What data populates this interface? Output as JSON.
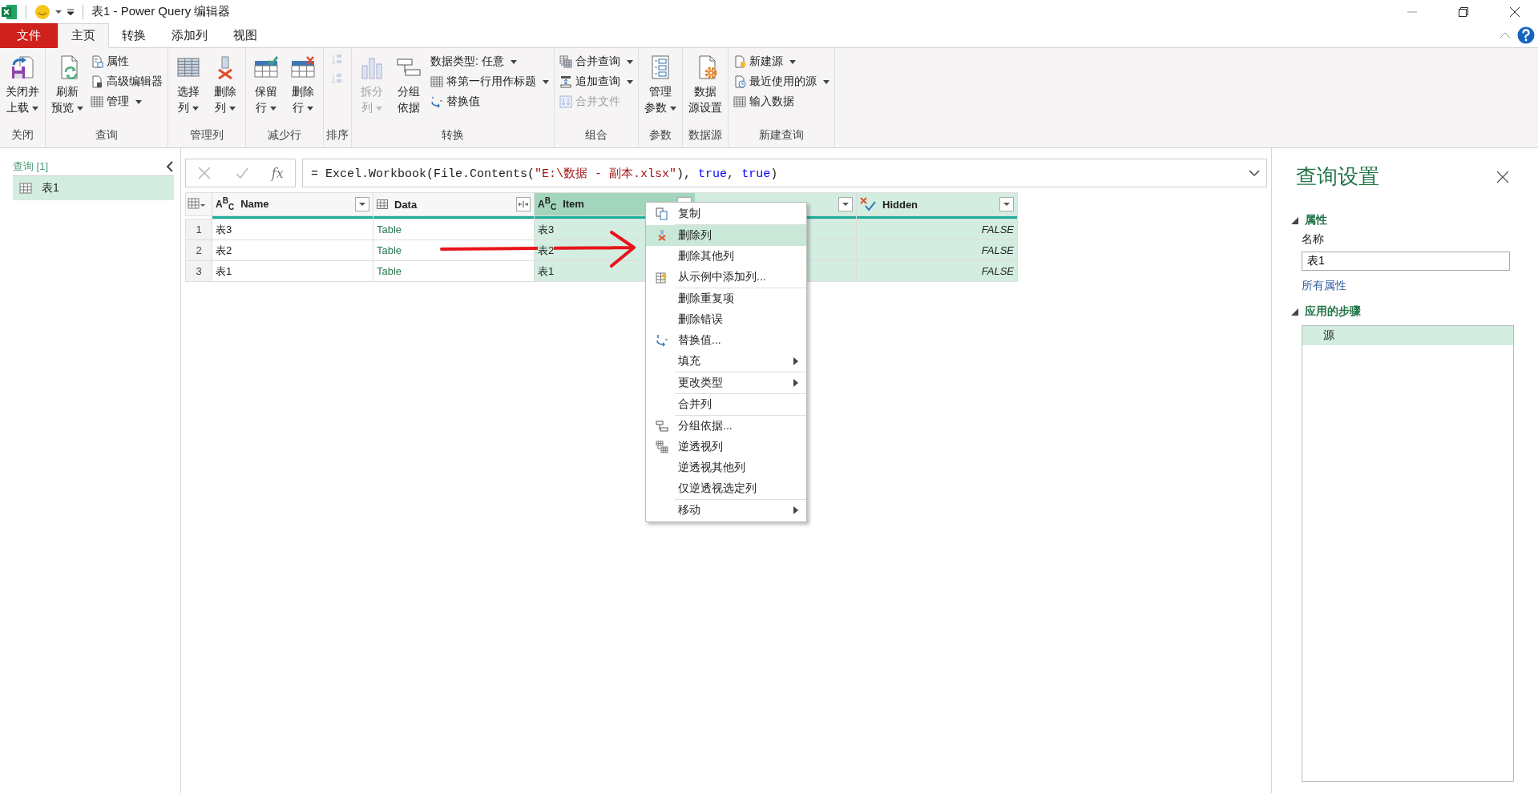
{
  "window": {
    "title": "表1 - Power Query 编辑器"
  },
  "menu_tabs": [
    {
      "label": "文件",
      "kind": "file",
      "selected": false
    },
    {
      "label": "主页",
      "kind": "tab",
      "selected": true
    },
    {
      "label": "转换",
      "kind": "tab",
      "selected": false
    },
    {
      "label": "添加列",
      "kind": "tab",
      "selected": false
    },
    {
      "label": "视图",
      "kind": "tab",
      "selected": false
    }
  ],
  "ribbon": {
    "groups": [
      {
        "label": "关闭",
        "items": [
          {
            "kind": "large",
            "lines": [
              "关闭并",
              "上载"
            ],
            "dropdown": true,
            "disabled": false
          }
        ]
      },
      {
        "label": "查询",
        "items": [
          {
            "kind": "large",
            "lines": [
              "刷新",
              "预览"
            ],
            "dropdown": true,
            "disabled": false
          },
          {
            "kind": "small",
            "label": "属性",
            "dropdown": false,
            "disabled": false
          },
          {
            "kind": "small",
            "label": "高级编辑器",
            "dropdown": false,
            "disabled": false
          },
          {
            "kind": "small",
            "label": "管理",
            "dropdown": true,
            "disabled": false
          }
        ]
      },
      {
        "label": "管理列",
        "items": [
          {
            "kind": "large",
            "lines": [
              "选择",
              "列"
            ],
            "dropdown": true,
            "disabled": false
          },
          {
            "kind": "large",
            "lines": [
              "删除",
              "列"
            ],
            "dropdown": true,
            "disabled": false
          }
        ]
      },
      {
        "label": "减少行",
        "items": [
          {
            "kind": "large",
            "lines": [
              "保留",
              "行"
            ],
            "dropdown": true,
            "disabled": false
          },
          {
            "kind": "large",
            "lines": [
              "删除",
              "行"
            ],
            "dropdown": true,
            "disabled": false
          }
        ]
      },
      {
        "label": "排序",
        "items": [
          {
            "kind": "icon",
            "disabled": true
          },
          {
            "kind": "icon",
            "disabled": true
          }
        ]
      },
      {
        "label": "转换",
        "items": [
          {
            "kind": "large",
            "lines": [
              "拆分",
              "列"
            ],
            "dropdown": true,
            "disabled": true
          },
          {
            "kind": "large",
            "lines": [
              "分组",
              "依据"
            ],
            "dropdown": false,
            "disabled": false
          },
          {
            "kind": "small",
            "label": "数据类型: 任意",
            "dropdown": true,
            "disabled": false
          },
          {
            "kind": "small",
            "label": "将第一行用作标题",
            "dropdown": true,
            "disabled": false
          },
          {
            "kind": "small",
            "label": "替换值",
            "dropdown": false,
            "disabled": false
          }
        ]
      },
      {
        "label": "组合",
        "items": [
          {
            "kind": "small",
            "label": "合并查询",
            "dropdown": true,
            "disabled": false
          },
          {
            "kind": "small",
            "label": "追加查询",
            "dropdown": true,
            "disabled": false
          },
          {
            "kind": "small",
            "label": "合并文件",
            "dropdown": false,
            "disabled": true
          }
        ]
      },
      {
        "label": "参数",
        "items": [
          {
            "kind": "large",
            "lines": [
              "管理",
              "参数"
            ],
            "dropdown": true,
            "disabled": false
          }
        ]
      },
      {
        "label": "数据源",
        "items": [
          {
            "kind": "large",
            "lines": [
              "数据",
              "源设置"
            ],
            "dropdown": false,
            "disabled": false
          }
        ]
      },
      {
        "label": "新建查询",
        "items": [
          {
            "kind": "small",
            "label": "新建源",
            "dropdown": true,
            "disabled": false
          },
          {
            "kind": "small",
            "label": "最近使用的源",
            "dropdown": true,
            "disabled": false
          },
          {
            "kind": "small",
            "label": "输入数据",
            "dropdown": false,
            "disabled": false
          }
        ]
      }
    ]
  },
  "queries": {
    "header": "查询 [1]",
    "items": [
      {
        "label": "表1",
        "selected": true
      }
    ]
  },
  "formula_bar": {
    "fx": "fx",
    "tokens": [
      {
        "text": "= Excel.Workbook(File.Contents(",
        "kind": "plain"
      },
      {
        "text": "\"E:\\数据 - 副本.xlsx\"",
        "kind": "string"
      },
      {
        "text": "), ",
        "kind": "plain"
      },
      {
        "text": "true",
        "kind": "keyword"
      },
      {
        "text": ", ",
        "kind": "plain"
      },
      {
        "text": "true",
        "kind": "keyword"
      },
      {
        "text": ")",
        "kind": "plain"
      }
    ]
  },
  "table": {
    "columns": [
      {
        "label": "Name",
        "kind": "text",
        "type_label": "A$^{B}$$_{C}$",
        "selected": false,
        "focused": false
      },
      {
        "label": "Data",
        "kind": "table",
        "selected": false,
        "focused": false
      },
      {
        "label": "Item",
        "kind": "text",
        "type_label": "A$^{B}$$_{C}$",
        "selected": true,
        "focused": true
      },
      {
        "kind": "covered",
        "selected": true,
        "focused": false
      },
      {
        "label": "Hidden",
        "kind": "logical",
        "selected": true,
        "focused": false
      }
    ],
    "rows": [
      {
        "number": "1",
        "cells": [
          "表3",
          "Table",
          "表3",
          "",
          "FALSE"
        ]
      },
      {
        "number": "2",
        "cells": [
          "表2",
          "Table",
          "表2",
          "",
          "FALSE"
        ]
      },
      {
        "number": "3",
        "cells": [
          "表1",
          "Table",
          "表1",
          "",
          "FALSE"
        ]
      }
    ]
  },
  "context_menu": {
    "groups": [
      [
        {
          "label": "复制",
          "selected": false,
          "submenu": false
        }
      ],
      [
        {
          "label": "删除列",
          "selected": true,
          "submenu": false
        },
        {
          "label": "删除其他列",
          "selected": false,
          "submenu": false
        },
        {
          "label": "从示例中添加列...",
          "selected": false,
          "submenu": false
        }
      ],
      [
        {
          "label": "删除重复项",
          "selected": false,
          "submenu": false
        },
        {
          "label": "删除错误",
          "selected": false,
          "submenu": false
        },
        {
          "label": "替换值...",
          "selected": false,
          "submenu": false
        },
        {
          "label": "填充",
          "selected": false,
          "submenu": true
        }
      ],
      [
        {
          "label": "更改类型",
          "selected": false,
          "submenu": true
        }
      ],
      [
        {
          "label": "合并列",
          "selected": false,
          "submenu": false
        }
      ],
      [
        {
          "label": "分组依据...",
          "selected": false,
          "submenu": false
        },
        {
          "label": "逆透视列",
          "selected": false,
          "submenu": false
        },
        {
          "label": "逆透视其他列",
          "selected": false,
          "submenu": false
        },
        {
          "label": "仅逆透视选定列",
          "selected": false,
          "submenu": false
        }
      ],
      [
        {
          "label": "移动",
          "selected": false,
          "submenu": true
        }
      ]
    ]
  },
  "query_settings": {
    "title": "查询设置",
    "properties": {
      "heading": "属性",
      "expanded": true,
      "name_label": "名称",
      "name_value": "表1",
      "link": "所有属性"
    },
    "steps": {
      "heading": "应用的步骤",
      "expanded": true,
      "items": [
        {
          "label": "源",
          "selected": true
        }
      ]
    }
  }
}
